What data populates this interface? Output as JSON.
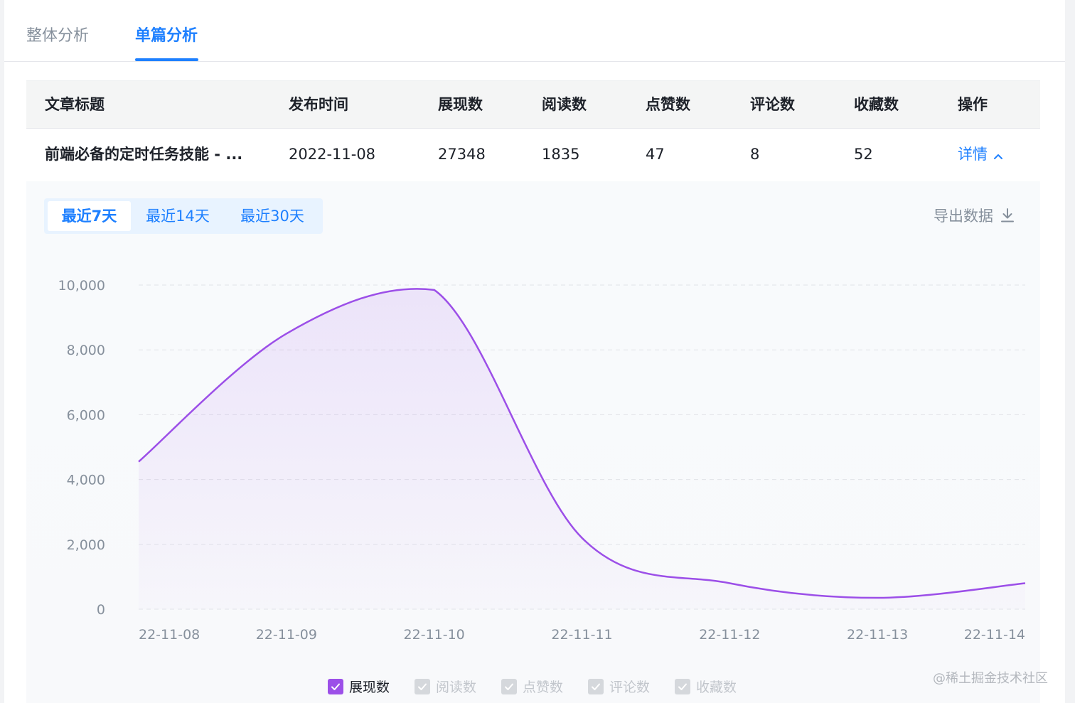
{
  "tabs": [
    {
      "label": "整体分析",
      "active": false
    },
    {
      "label": "单篇分析",
      "active": true
    }
  ],
  "table": {
    "columns": [
      "文章标题",
      "发布时间",
      "展现数",
      "阅读数",
      "点赞数",
      "评论数",
      "收藏数",
      "操作"
    ],
    "row": {
      "title": "前端必备的定时任务技能 - ...",
      "date": "2022-11-08",
      "impressions": "27348",
      "reads": "1835",
      "likes": "47",
      "comments": "8",
      "favorites": "52",
      "action": "详情"
    }
  },
  "detail": {
    "ranges": [
      {
        "label": "最近7天",
        "active": true
      },
      {
        "label": "最近14天",
        "active": false
      },
      {
        "label": "最近30天",
        "active": false
      }
    ],
    "export_label": "导出数据"
  },
  "chart_data": {
    "type": "area",
    "x": [
      "22-11-08",
      "22-11-09",
      "22-11-10",
      "22-11-11",
      "22-11-12",
      "22-11-13",
      "22-11-14"
    ],
    "series": [
      {
        "name": "展现数",
        "values": [
          4550,
          8500,
          9850,
          2200,
          800,
          350,
          800
        ],
        "color": "#9c4fe8",
        "checked": true
      },
      {
        "name": "阅读数",
        "checked": false
      },
      {
        "name": "点赞数",
        "checked": false
      },
      {
        "name": "评论数",
        "checked": false
      },
      {
        "name": "收藏数",
        "checked": false
      }
    ],
    "y_ticks": [
      "0",
      "2,000",
      "4,000",
      "6,000",
      "8,000",
      "10,000"
    ],
    "ylim": [
      0,
      10000
    ],
    "grid": true,
    "legend_position": "bottom-center"
  },
  "watermark": "@稀土掘金技术社区",
  "colors": {
    "accent": "#1e80ff",
    "series": "#9c4fe8",
    "muted": "#86909c"
  }
}
